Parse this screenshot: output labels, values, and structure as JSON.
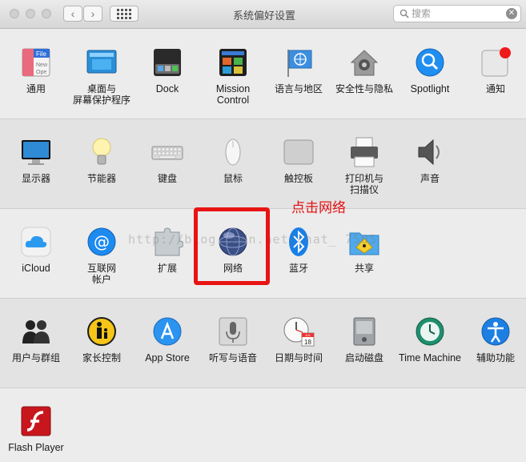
{
  "window": {
    "title": "系统偏好设置",
    "search_placeholder": "搜索",
    "search_icon": "magnifier-icon",
    "clear_icon": "x-icon"
  },
  "sections": [
    {
      "items": [
        {
          "label": "通用",
          "icon": "general-icon"
        },
        {
          "label": "桌面与\n屏幕保护程序",
          "icon": "desktop-icon"
        },
        {
          "label": "Dock",
          "icon": "dock-icon"
        },
        {
          "label": "Mission\nControl",
          "icon": "mission-control-icon"
        },
        {
          "label": "语言与地区",
          "icon": "globe-flag-icon"
        },
        {
          "label": "安全性与隐私",
          "icon": "house-lock-icon"
        },
        {
          "label": "Spotlight",
          "icon": "spotlight-icon"
        },
        {
          "label": "通知",
          "icon": "notifications-icon"
        }
      ]
    },
    {
      "items": [
        {
          "label": "显示器",
          "icon": "display-icon"
        },
        {
          "label": "节能器",
          "icon": "bulb-icon"
        },
        {
          "label": "键盘",
          "icon": "keyboard-icon"
        },
        {
          "label": "鼠标",
          "icon": "mouse-icon"
        },
        {
          "label": "触控板",
          "icon": "trackpad-icon"
        },
        {
          "label": "打印机与\n扫描仪",
          "icon": "printer-icon"
        },
        {
          "label": "声音",
          "icon": "speaker-icon"
        }
      ]
    },
    {
      "items": [
        {
          "label": "iCloud",
          "icon": "icloud-icon"
        },
        {
          "label": "互联网\n帐户",
          "icon": "at-icon"
        },
        {
          "label": "扩展",
          "icon": "puzzle-icon"
        },
        {
          "label": "网络",
          "icon": "network-globe-icon"
        },
        {
          "label": "蓝牙",
          "icon": "bluetooth-icon"
        },
        {
          "label": "共享",
          "icon": "sharing-folder-icon"
        }
      ]
    },
    {
      "items": [
        {
          "label": "用户与群组",
          "icon": "users-icon"
        },
        {
          "label": "家长控制",
          "icon": "parental-icon"
        },
        {
          "label": "App Store",
          "icon": "appstore-icon"
        },
        {
          "label": "听写与语音",
          "icon": "microphone-icon"
        },
        {
          "label": "日期与时间",
          "icon": "clock-calendar-icon"
        },
        {
          "label": "启动磁盘",
          "icon": "disk-icon"
        },
        {
          "label": "Time Machine",
          "icon": "time-machine-icon"
        },
        {
          "label": "辅助功能",
          "icon": "accessibility-icon"
        }
      ]
    },
    {
      "items": [
        {
          "label": "Flash Player",
          "icon": "flash-icon"
        }
      ]
    }
  ],
  "icon_texts": {
    "general_file": "File",
    "general_lines": "New\nOpe",
    "calendar_month": "JUL",
    "calendar_day": "18"
  },
  "annotation": "点击网络",
  "watermark": "http://blog.csdn.net/chat_    7505",
  "colors": {
    "highlight": "#e81313",
    "accent_blue": "#1a8cff"
  }
}
